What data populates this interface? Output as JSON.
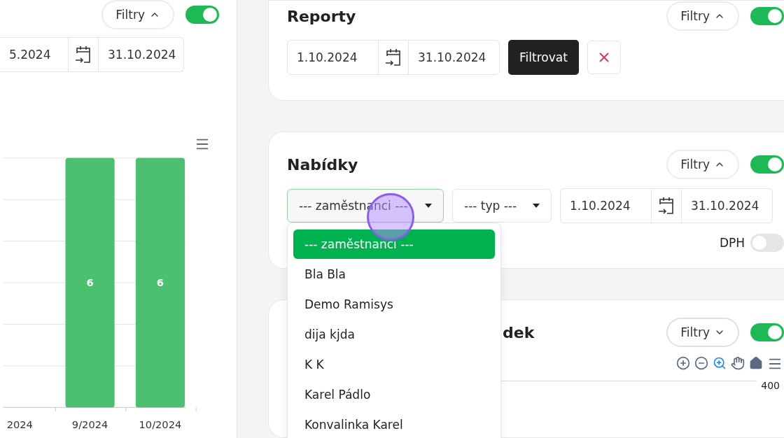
{
  "left_panel": {
    "filters": {
      "label": "Filtry",
      "expanded": true
    },
    "enabled": true,
    "date_from": "5.2024",
    "date_to": "31.10.2024",
    "chart_data": {
      "type": "bar",
      "categories": [
        "2024",
        "9/2024",
        "10/2024"
      ],
      "values": [
        null,
        6,
        6
      ],
      "ylim": [
        0,
        6
      ],
      "data_labels": true,
      "color": "#4bc16f"
    }
  },
  "reports": {
    "title": "Reporty",
    "filters": {
      "label": "Filtry",
      "expanded": true
    },
    "enabled": true,
    "date_from": "1.10.2024",
    "date_to": "31.10.2024",
    "submit_label": "Filtrovat"
  },
  "offers": {
    "title": "Nabídky",
    "filters": {
      "label": "Filtry",
      "expanded": true
    },
    "enabled": true,
    "employee_select": {
      "value": "--- zaměstnanci ---",
      "focused": true
    },
    "type_select": {
      "value": "--- typ ---"
    },
    "date_from": "1.10.2024",
    "date_to": "31.10.2024",
    "vat": {
      "label": "DPH",
      "on": false
    },
    "dropdown": [
      {
        "label": "--- zaměstnanci ---",
        "selected": true
      },
      {
        "label": "Bla Bla",
        "selected": false
      },
      {
        "label": "Demo Ramisys",
        "selected": false
      },
      {
        "label": "dija kjda",
        "selected": false
      },
      {
        "label": "K K",
        "selected": false
      },
      {
        "label": "Karel Pádlo",
        "selected": false
      },
      {
        "label": "Konvalinka Karel",
        "selected": false
      }
    ]
  },
  "third_card": {
    "title": "dek",
    "filters": {
      "label": "Filtry",
      "expanded": false
    },
    "enabled": true,
    "axis_label": "400"
  }
}
